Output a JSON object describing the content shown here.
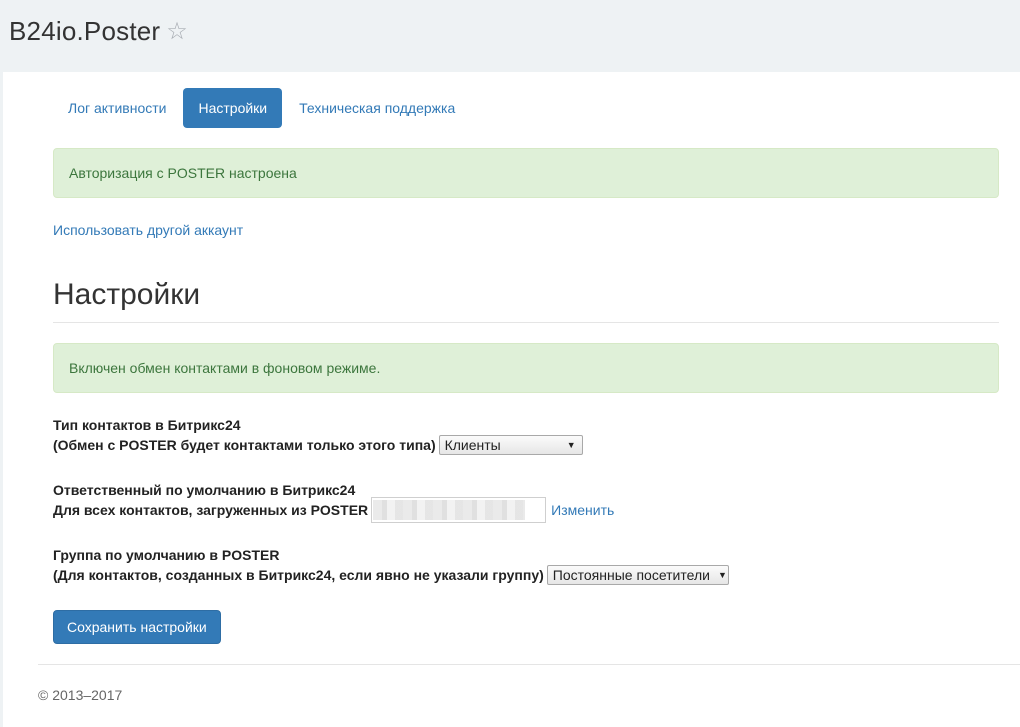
{
  "app": {
    "title": "B24io.Poster",
    "favorite_icon": "star-outline-icon"
  },
  "tabs": [
    {
      "label": "Лог активности",
      "active": false
    },
    {
      "label": "Настройки",
      "active": true
    },
    {
      "label": "Техническая поддержка",
      "active": false
    }
  ],
  "auth_alert": {
    "text": "Авторизация с POSTER настроена"
  },
  "other_account_link": "Использовать другой аккаунт",
  "settings": {
    "title": "Настройки",
    "background_alert": "Включен обмен контактами в фоновом режиме.",
    "contact_type": {
      "label": "Тип контактов в Битрикс24",
      "hint": "(Обмен с POSTER будет контактами только этого типа)",
      "selected": "Клиенты"
    },
    "responsible": {
      "label": "Ответственный по умолчанию в Битрикс24",
      "hint": "Для всех контактов, загруженных из POSTER",
      "change_link": "Изменить"
    },
    "group": {
      "label": "Группа по умолчанию в POSTER",
      "hint": "(Для контактов, созданных в Битрикс24, если явно не указали группу)",
      "selected": "Постоянные посетители"
    },
    "save_label": "Сохранить настройки"
  },
  "footer": {
    "copyright": "© 2013–2017"
  },
  "colors": {
    "primary": "#337ab7",
    "alert_bg": "#dff0d8",
    "alert_text": "#3c763d",
    "header_bg": "#eef2f4"
  }
}
